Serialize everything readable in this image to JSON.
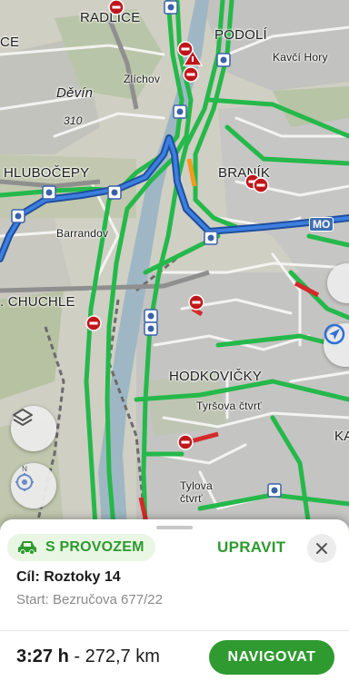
{
  "map": {
    "labels": {
      "radlice": "RADLICE",
      "podoli": "PODOLÍ",
      "ce": "CE",
      "kavci_hory": "Kavčí Hory",
      "zlichov": "Zlíchov",
      "devin": "Děvín",
      "road_310": "310",
      "hlubocepy": "HLUBOČEPY",
      "branik": "BRANÍK",
      "barrandov": "Barrandov",
      "chuchle": ". CHUCHLE",
      "hodkovicky": "HODKOVIČKY",
      "tyrsova": "Tyršova čtvrť",
      "tylova_1": "Tylova",
      "tylova_2": "čtvrť",
      "ka": "KA",
      "mo": "MO"
    },
    "icons": [
      "speed-camera-icon",
      "no-entry-icon",
      "roadwork-icon",
      "layers-icon",
      "compass-icon",
      "location-arrow-icon"
    ],
    "colors": {
      "route": "#2f6fd6",
      "traffic_free": "#25b84a",
      "traffic_slow": "#f29b1d",
      "traffic_jam": "#d42a2a",
      "river": "#9fb7c4"
    }
  },
  "sheet": {
    "mode_chip": "S PROVOZEM",
    "edit_label": "UPRAVIT",
    "destination": "Cíl: Roztoky 14",
    "start": "Start: Bezručova 677/22",
    "duration": "3:27 h",
    "separator": " - ",
    "distance": "272,7 km",
    "navigate_label": "NAVIGOVAT",
    "colors": {
      "accent": "#2e9a2f",
      "chip_bg": "#e9f6e4"
    }
  }
}
